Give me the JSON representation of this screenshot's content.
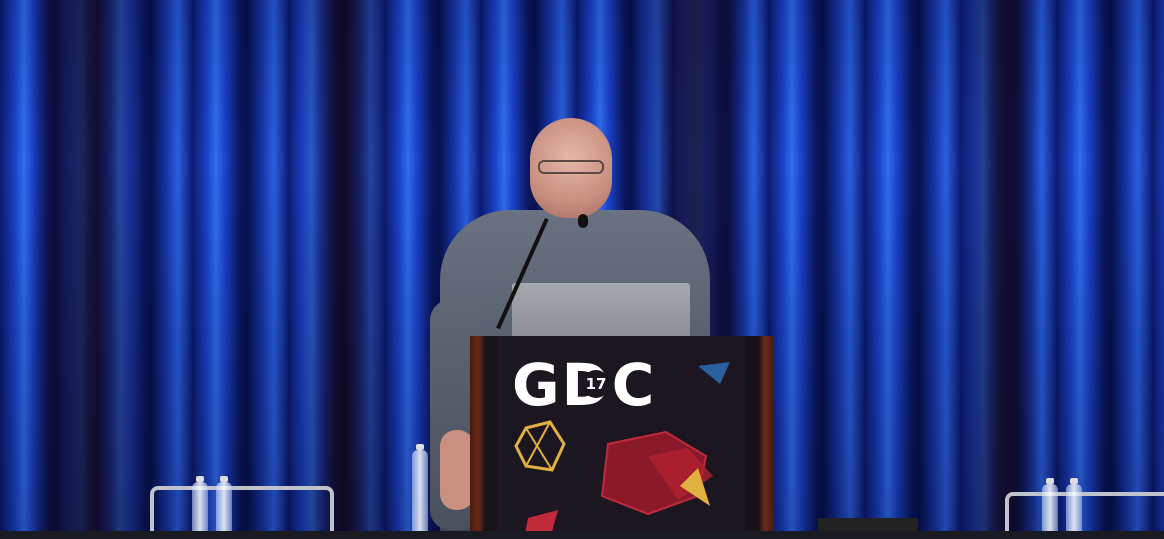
{
  "scene": {
    "description_tags": [
      "stage",
      "curtain-blue",
      "speaker",
      "podium",
      "laptop",
      "microphone",
      "water-bottles"
    ]
  },
  "podium": {
    "logo_text": "GDC",
    "logo_year": "17"
  },
  "colors": {
    "curtain": "#1a3fc4",
    "podium": "#1c1620",
    "logo": "#ffffff"
  }
}
